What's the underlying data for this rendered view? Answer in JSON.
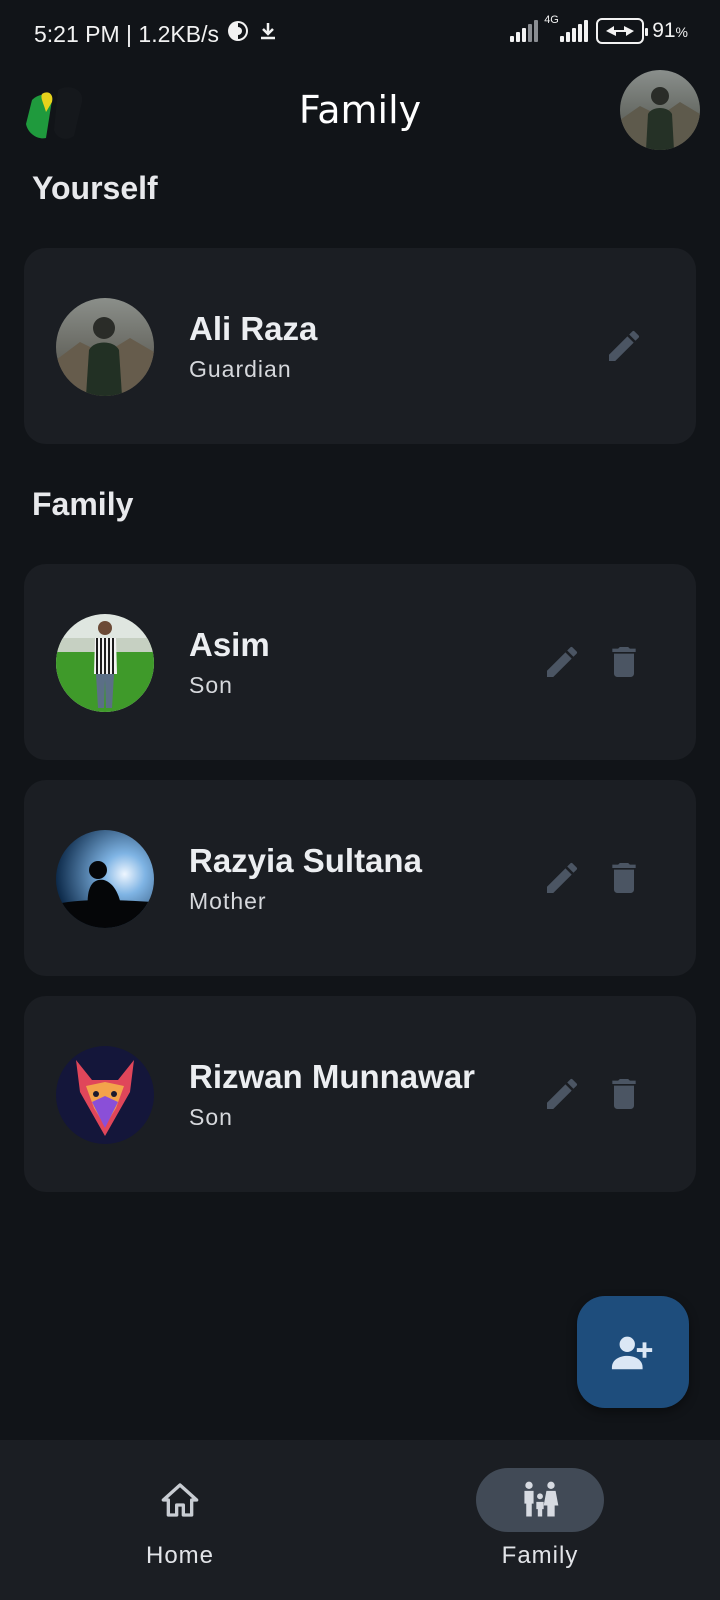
{
  "status_bar": {
    "time_speed": "5:21 PM | 1.2KB/s",
    "network_type": "4G",
    "battery_percent": "91",
    "battery_unit": "%"
  },
  "app_bar": {
    "title": "Family",
    "logo_icon": "app-logo",
    "profile_icon": "profile-avatar"
  },
  "yourself": {
    "section_title": "Yourself",
    "member": {
      "name": "Ali Raza",
      "role": "Guardian"
    }
  },
  "family": {
    "section_title": "Family",
    "members": [
      {
        "name": "Asim",
        "role": "Son"
      },
      {
        "name": "Razyia Sultana",
        "role": "Mother"
      },
      {
        "name": "Rizwan Munnawar",
        "role": "Son"
      }
    ]
  },
  "fab": {
    "icon": "add-person-icon"
  },
  "bottom_nav": {
    "items": [
      {
        "label": "Home",
        "icon": "home-icon",
        "active": false
      },
      {
        "label": "Family",
        "icon": "family-icon",
        "active": true
      }
    ]
  },
  "colors": {
    "background": "#111418",
    "card": "#1b1e23",
    "fab": "#1e4d7c",
    "active_pill": "#414a56",
    "icon_muted": "#4b5563"
  }
}
